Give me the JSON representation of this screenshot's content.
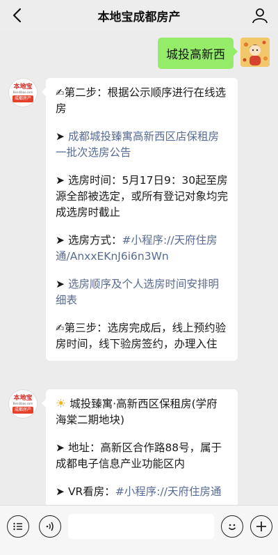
{
  "header": {
    "title": "本地宝成都房产",
    "back_icon": "chevron-left-icon",
    "user_icon": "person-icon"
  },
  "outgoing_message": {
    "text": "城投高新西"
  },
  "brand_avatar": {
    "logo_text": "本地宝",
    "logo_sub": "Bendibao.com",
    "logo_bar": "成都房产"
  },
  "message1": {
    "step2_title": "第二步：根据公示顺序进行在线选房",
    "link_announcement": "成都城投臻寓高新西区店保租房一批次选房公告",
    "time_text": "选房时间：5月17日9：30起至房源全部被选定，或所有登记对象均完成选房时截止",
    "method_label": "选房方式：",
    "method_link": "#小程序://天府住房通/AnxxEKnJ6i6n3Wn",
    "link_schedule": "选房顺序及个人选房时间安排明细表",
    "step3_title": "第三步：选房完成后，线上预约验房时间，线下验房签约，办理入住",
    "arrow": "➤",
    "writing_emoji": "✍"
  },
  "message2": {
    "sun_emoji": "☀",
    "title": "城投臻寓·高新西区保租房(学府海棠二期地块)",
    "address": "地址：高新区合作路88号，属于成都电子信息产业功能区内",
    "vr_label": "VR看房：",
    "vr_link": "#小程序://天府住房通",
    "arrow": "➤"
  },
  "input_bar": {
    "left_icon": "menu-list-icon",
    "voice_icon": "voice-icon",
    "emoji_icon": "smiley-icon",
    "plus_icon": "plus-icon"
  },
  "colors": {
    "bubble_green": "#95ec69",
    "link_blue": "#576b95",
    "background": "#ececec"
  }
}
